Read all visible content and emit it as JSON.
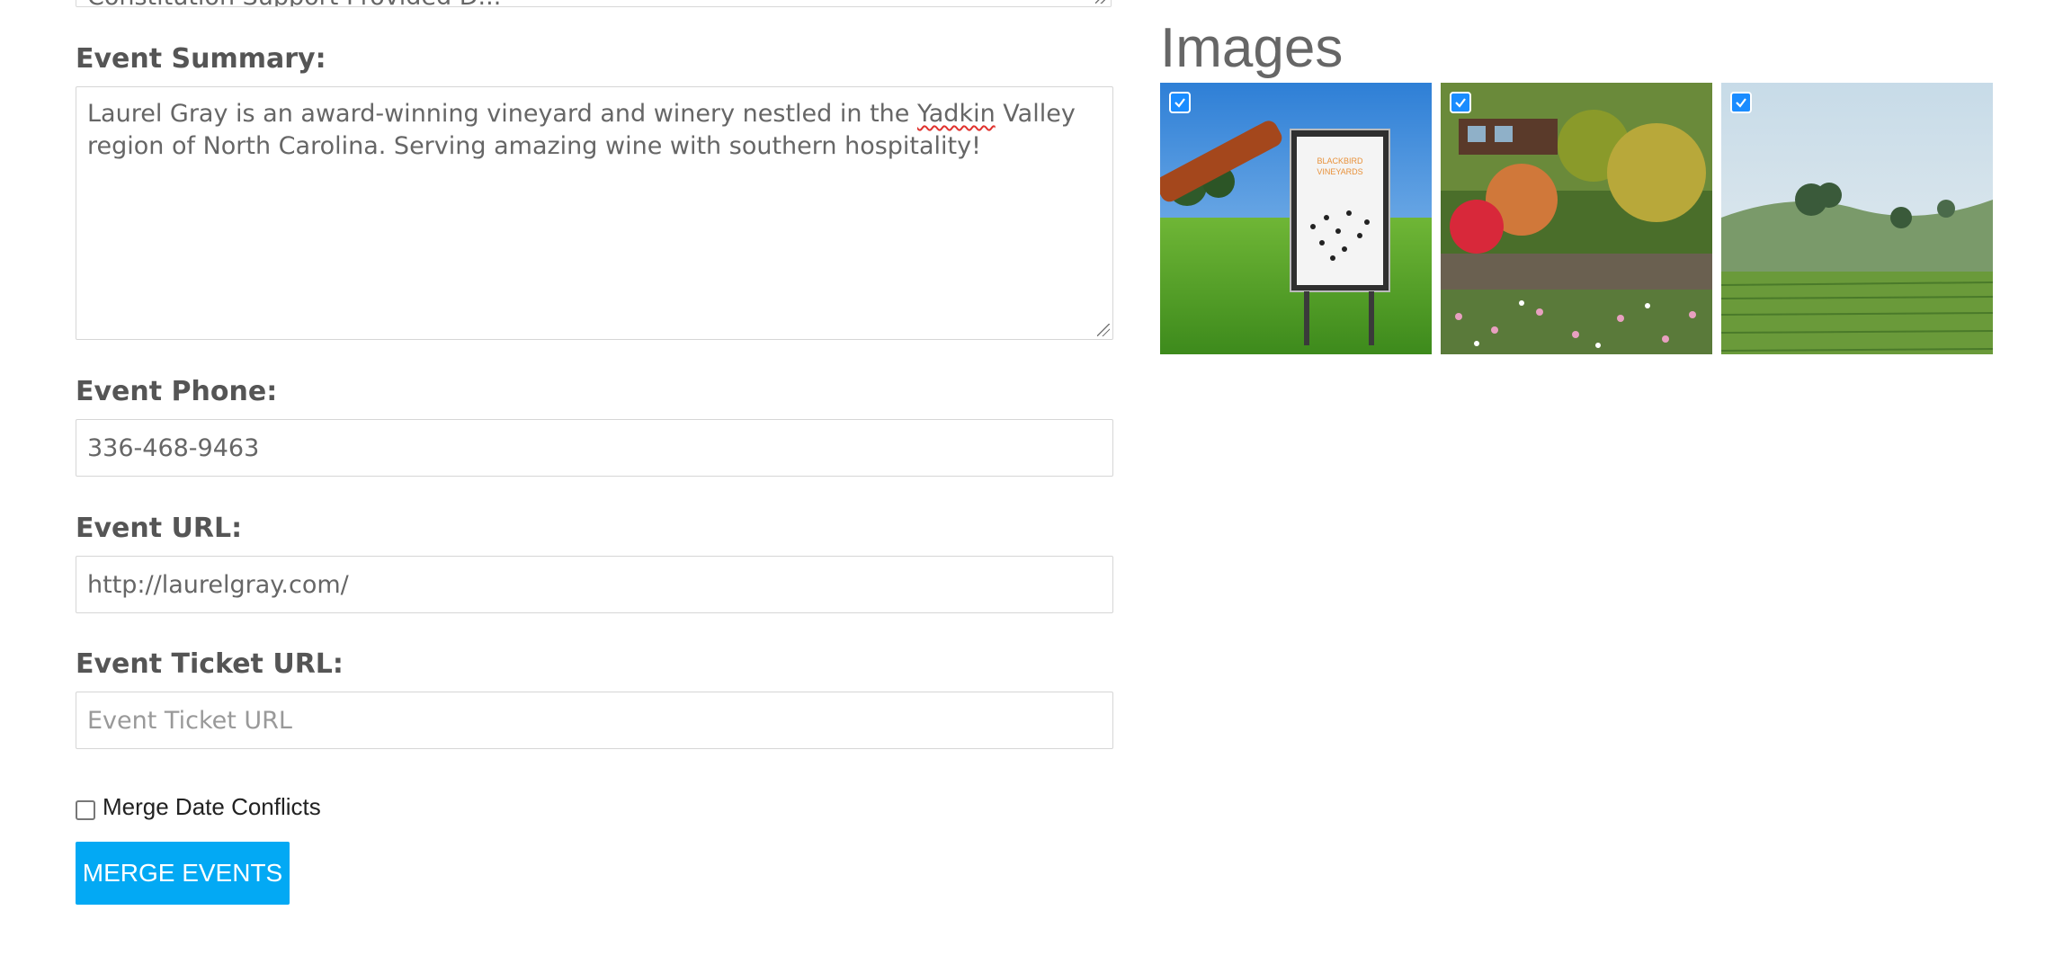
{
  "form": {
    "top_textarea_cut": "Constitution Support Provided D...",
    "summary_label": "Event Summary:",
    "summary_text_before": "Laurel Gray is an award-winning vineyard and winery nestled in the ",
    "summary_text_misspelled": "Yadkin",
    "summary_text_after": " Valley region of North Carolina. Serving amazing wine with southern hospitality!",
    "phone_label": "Event Phone:",
    "phone_value": "336-468-9463",
    "url_label": "Event URL:",
    "url_value": "http://laurelgray.com/",
    "ticket_label": "Event Ticket URL:",
    "ticket_placeholder": "Event Ticket URL",
    "merge_conflicts_label": "Merge Date Conflicts",
    "merge_conflicts_checked": false,
    "merge_button": "MERGE EVENTS"
  },
  "images": {
    "title": "Images",
    "items": [
      {
        "name": "blackbird-vineyards-sign",
        "checked": true,
        "sign_text": "BLACKBIRD VINEYARDS"
      },
      {
        "name": "winery-garden-flowers",
        "checked": true
      },
      {
        "name": "vineyard-hills",
        "checked": true
      }
    ]
  },
  "colors": {
    "accent": "#03a9f4",
    "check_blue": "#1a8cff",
    "text": "#555555",
    "border": "#d6d6d6"
  }
}
